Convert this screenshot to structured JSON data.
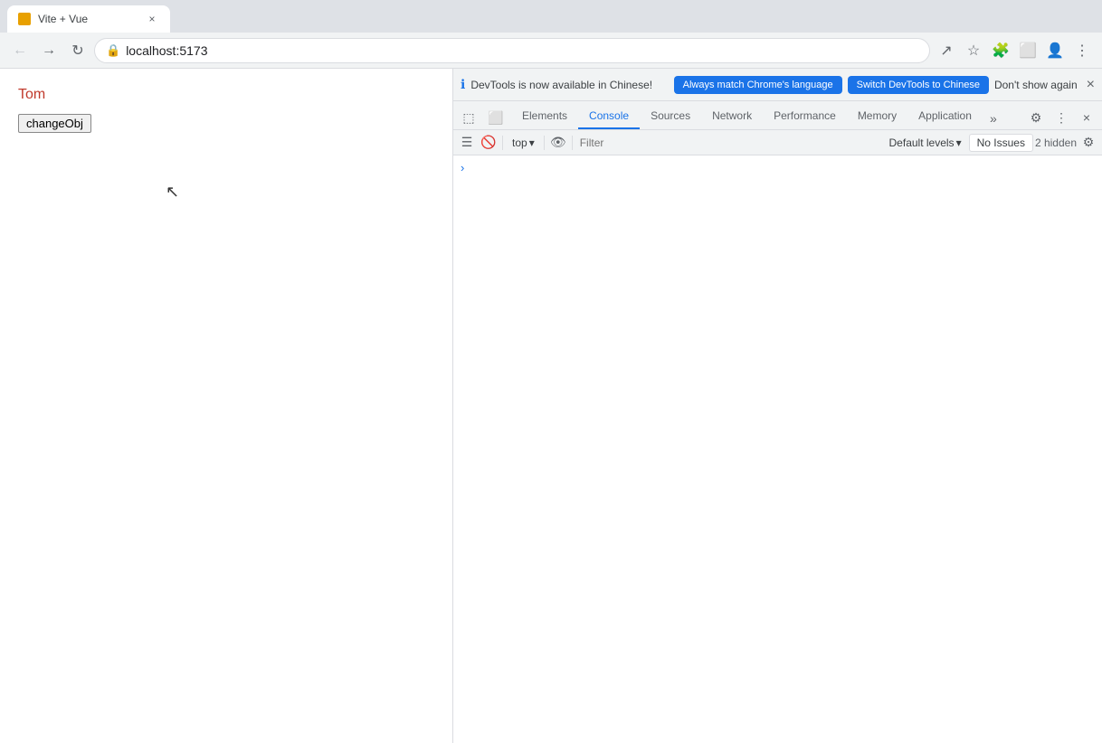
{
  "browser": {
    "tab": {
      "title": "Vite + Vue"
    },
    "address": {
      "url": "localhost:5173",
      "lock_icon": "🔒"
    },
    "nav": {
      "back_label": "←",
      "forward_label": "→",
      "reload_label": "↻"
    },
    "toolbar_icons": {
      "share": "↗",
      "bookmark": "☆",
      "extensions": "🧩",
      "split": "⬜",
      "profile": "👤",
      "more": "⋮"
    }
  },
  "page": {
    "name": "Tom",
    "button_label": "changeObj"
  },
  "devtools": {
    "notification": {
      "info_icon": "ℹ",
      "text": "DevTools is now available in Chinese!",
      "btn_match": "Always match Chrome's language",
      "btn_switch": "Switch DevTools to Chinese",
      "dont_show": "Don't show again",
      "close_icon": "×"
    },
    "tabs": {
      "items": [
        {
          "label": "Elements",
          "active": false
        },
        {
          "label": "Console",
          "active": true
        },
        {
          "label": "Sources",
          "active": false
        },
        {
          "label": "Network",
          "active": false
        },
        {
          "label": "Performance",
          "active": false
        },
        {
          "label": "Memory",
          "active": false
        },
        {
          "label": "Application",
          "active": false
        }
      ],
      "overflow_icon": "»",
      "settings_icon": "⚙",
      "more_icon": "⋮",
      "close_icon": "×"
    },
    "console_toolbar": {
      "sidebar_icon": "☰",
      "clear_icon": "🚫",
      "top_label": "top",
      "dropdown_icon": "▾",
      "eye_icon": "👁",
      "filter_placeholder": "Filter",
      "levels_label": "Default levels",
      "levels_dropdown": "▾",
      "no_issues": "No Issues",
      "hidden": "2 hidden",
      "settings_icon": "⚙"
    },
    "console": {
      "prompt_arrow": "›"
    }
  }
}
